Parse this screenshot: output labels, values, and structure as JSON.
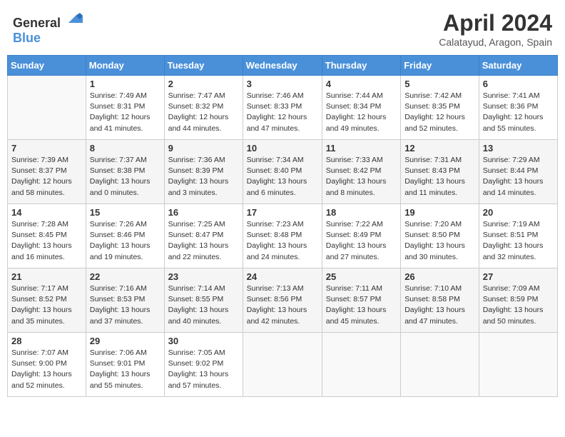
{
  "header": {
    "logo_general": "General",
    "logo_blue": "Blue",
    "month_year": "April 2024",
    "location": "Calatayud, Aragon, Spain"
  },
  "days_of_week": [
    "Sunday",
    "Monday",
    "Tuesday",
    "Wednesday",
    "Thursday",
    "Friday",
    "Saturday"
  ],
  "weeks": [
    [
      {
        "day": "",
        "info": ""
      },
      {
        "day": "1",
        "info": "Sunrise: 7:49 AM\nSunset: 8:31 PM\nDaylight: 12 hours\nand 41 minutes."
      },
      {
        "day": "2",
        "info": "Sunrise: 7:47 AM\nSunset: 8:32 PM\nDaylight: 12 hours\nand 44 minutes."
      },
      {
        "day": "3",
        "info": "Sunrise: 7:46 AM\nSunset: 8:33 PM\nDaylight: 12 hours\nand 47 minutes."
      },
      {
        "day": "4",
        "info": "Sunrise: 7:44 AM\nSunset: 8:34 PM\nDaylight: 12 hours\nand 49 minutes."
      },
      {
        "day": "5",
        "info": "Sunrise: 7:42 AM\nSunset: 8:35 PM\nDaylight: 12 hours\nand 52 minutes."
      },
      {
        "day": "6",
        "info": "Sunrise: 7:41 AM\nSunset: 8:36 PM\nDaylight: 12 hours\nand 55 minutes."
      }
    ],
    [
      {
        "day": "7",
        "info": "Sunrise: 7:39 AM\nSunset: 8:37 PM\nDaylight: 12 hours\nand 58 minutes."
      },
      {
        "day": "8",
        "info": "Sunrise: 7:37 AM\nSunset: 8:38 PM\nDaylight: 13 hours\nand 0 minutes."
      },
      {
        "day": "9",
        "info": "Sunrise: 7:36 AM\nSunset: 8:39 PM\nDaylight: 13 hours\nand 3 minutes."
      },
      {
        "day": "10",
        "info": "Sunrise: 7:34 AM\nSunset: 8:40 PM\nDaylight: 13 hours\nand 6 minutes."
      },
      {
        "day": "11",
        "info": "Sunrise: 7:33 AM\nSunset: 8:42 PM\nDaylight: 13 hours\nand 8 minutes."
      },
      {
        "day": "12",
        "info": "Sunrise: 7:31 AM\nSunset: 8:43 PM\nDaylight: 13 hours\nand 11 minutes."
      },
      {
        "day": "13",
        "info": "Sunrise: 7:29 AM\nSunset: 8:44 PM\nDaylight: 13 hours\nand 14 minutes."
      }
    ],
    [
      {
        "day": "14",
        "info": "Sunrise: 7:28 AM\nSunset: 8:45 PM\nDaylight: 13 hours\nand 16 minutes."
      },
      {
        "day": "15",
        "info": "Sunrise: 7:26 AM\nSunset: 8:46 PM\nDaylight: 13 hours\nand 19 minutes."
      },
      {
        "day": "16",
        "info": "Sunrise: 7:25 AM\nSunset: 8:47 PM\nDaylight: 13 hours\nand 22 minutes."
      },
      {
        "day": "17",
        "info": "Sunrise: 7:23 AM\nSunset: 8:48 PM\nDaylight: 13 hours\nand 24 minutes."
      },
      {
        "day": "18",
        "info": "Sunrise: 7:22 AM\nSunset: 8:49 PM\nDaylight: 13 hours\nand 27 minutes."
      },
      {
        "day": "19",
        "info": "Sunrise: 7:20 AM\nSunset: 8:50 PM\nDaylight: 13 hours\nand 30 minutes."
      },
      {
        "day": "20",
        "info": "Sunrise: 7:19 AM\nSunset: 8:51 PM\nDaylight: 13 hours\nand 32 minutes."
      }
    ],
    [
      {
        "day": "21",
        "info": "Sunrise: 7:17 AM\nSunset: 8:52 PM\nDaylight: 13 hours\nand 35 minutes."
      },
      {
        "day": "22",
        "info": "Sunrise: 7:16 AM\nSunset: 8:53 PM\nDaylight: 13 hours\nand 37 minutes."
      },
      {
        "day": "23",
        "info": "Sunrise: 7:14 AM\nSunset: 8:55 PM\nDaylight: 13 hours\nand 40 minutes."
      },
      {
        "day": "24",
        "info": "Sunrise: 7:13 AM\nSunset: 8:56 PM\nDaylight: 13 hours\nand 42 minutes."
      },
      {
        "day": "25",
        "info": "Sunrise: 7:11 AM\nSunset: 8:57 PM\nDaylight: 13 hours\nand 45 minutes."
      },
      {
        "day": "26",
        "info": "Sunrise: 7:10 AM\nSunset: 8:58 PM\nDaylight: 13 hours\nand 47 minutes."
      },
      {
        "day": "27",
        "info": "Sunrise: 7:09 AM\nSunset: 8:59 PM\nDaylight: 13 hours\nand 50 minutes."
      }
    ],
    [
      {
        "day": "28",
        "info": "Sunrise: 7:07 AM\nSunset: 9:00 PM\nDaylight: 13 hours\nand 52 minutes."
      },
      {
        "day": "29",
        "info": "Sunrise: 7:06 AM\nSunset: 9:01 PM\nDaylight: 13 hours\nand 55 minutes."
      },
      {
        "day": "30",
        "info": "Sunrise: 7:05 AM\nSunset: 9:02 PM\nDaylight: 13 hours\nand 57 minutes."
      },
      {
        "day": "",
        "info": ""
      },
      {
        "day": "",
        "info": ""
      },
      {
        "day": "",
        "info": ""
      },
      {
        "day": "",
        "info": ""
      }
    ]
  ]
}
